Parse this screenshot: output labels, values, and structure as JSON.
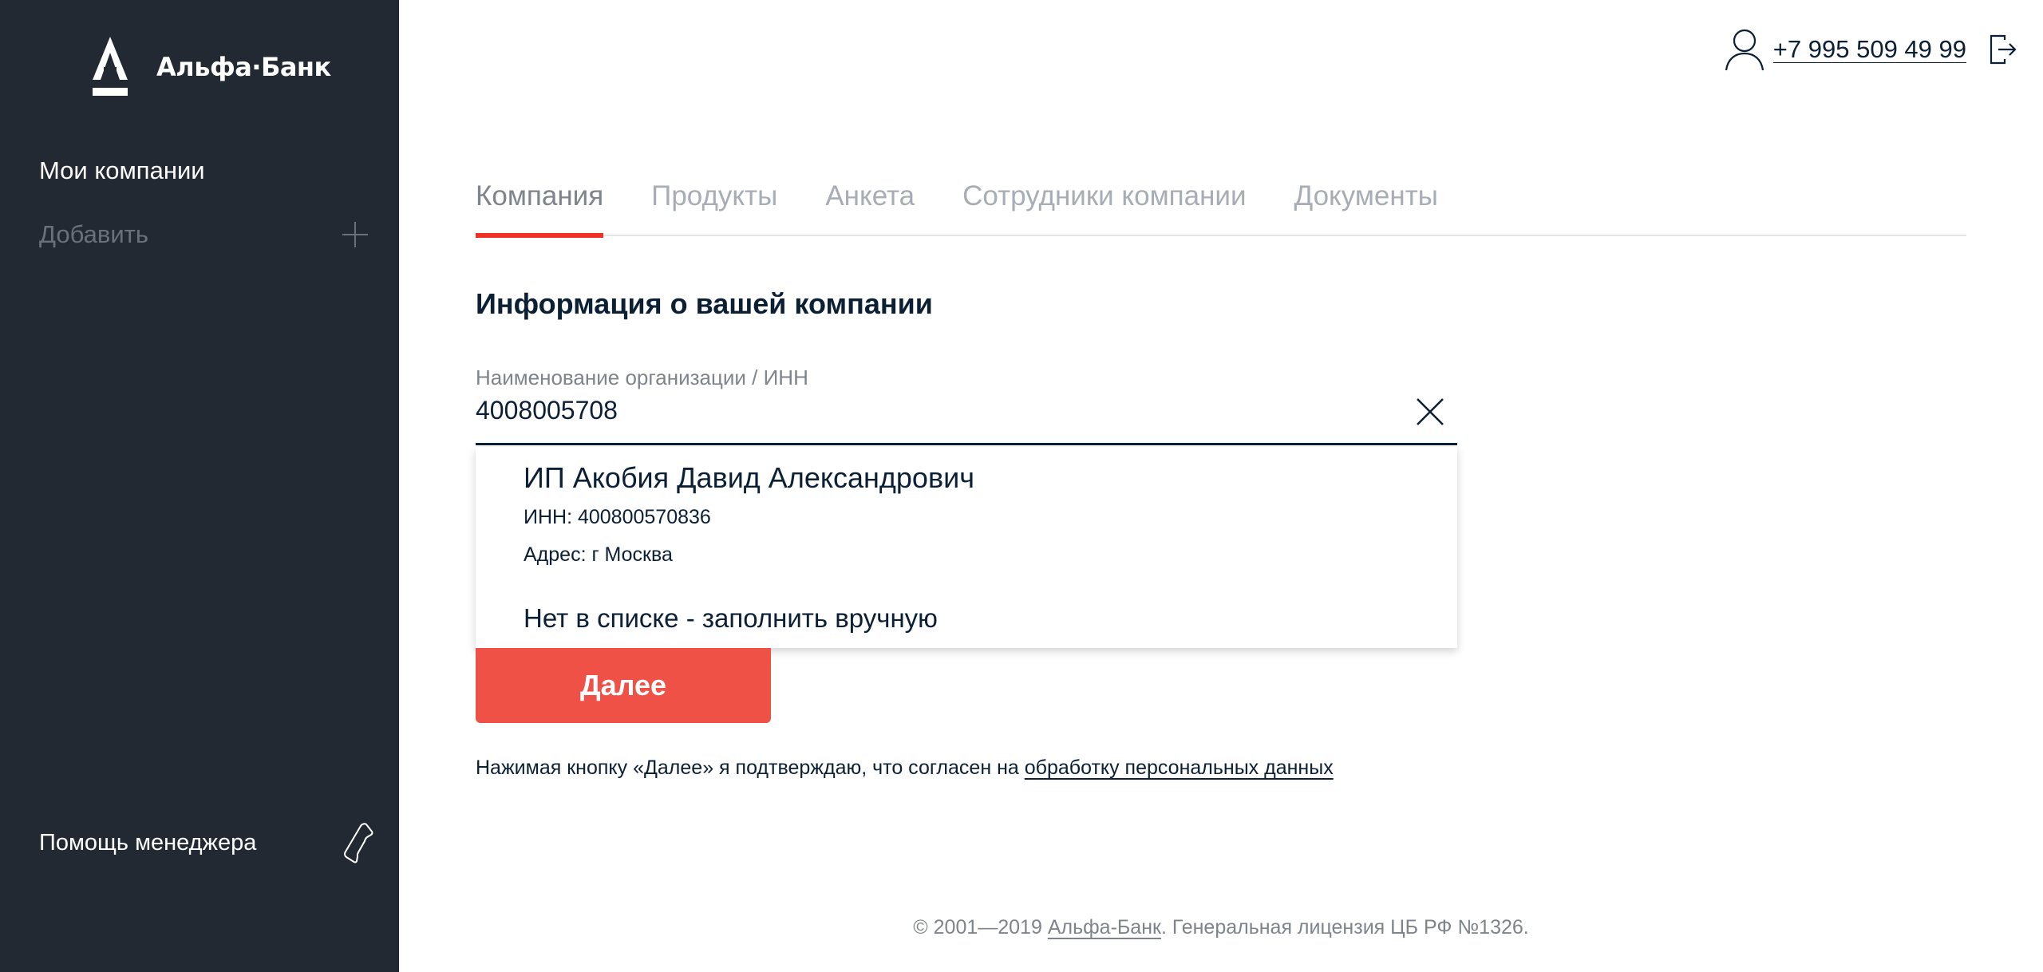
{
  "sidebar": {
    "logo_text": "Альфа·Банк",
    "title": "Мои компании",
    "add_label": "Добавить",
    "help_label": "Помощь менеджера"
  },
  "header": {
    "phone": "+7 995 509 49 99"
  },
  "tabs": [
    {
      "label": "Компания",
      "active": true
    },
    {
      "label": "Продукты",
      "active": false
    },
    {
      "label": "Анкета",
      "active": false
    },
    {
      "label": "Сотрудники компании",
      "active": false
    },
    {
      "label": "Документы",
      "active": false
    }
  ],
  "form": {
    "section_title": "Информация о вашей компании",
    "field_label": "Наименование организации / ИНН",
    "field_value": "4008005708"
  },
  "dropdown": {
    "suggestion": {
      "name": "ИП Акобия Давид Александрович",
      "inn": "ИНН: 400800570836",
      "address": "Адрес: г Москва"
    },
    "manual_label": "Нет в списке - заполнить вручную"
  },
  "next_button": "Далее",
  "consent": {
    "text": "Нажимая кнопку «Далее» я подтверждаю, что согласен на ",
    "link": "обработку персональных данных"
  },
  "footer": {
    "prefix": "© 2001—2019 ",
    "link": "Альфа-Банк",
    "suffix": ". Генеральная лицензия ЦБ РФ №1326."
  },
  "colors": {
    "sidebar_bg": "#232932",
    "accent_red": "#ef3124",
    "button_red": "#f05147",
    "text_dark": "#0b1f35",
    "text_muted": "#7e848c"
  }
}
